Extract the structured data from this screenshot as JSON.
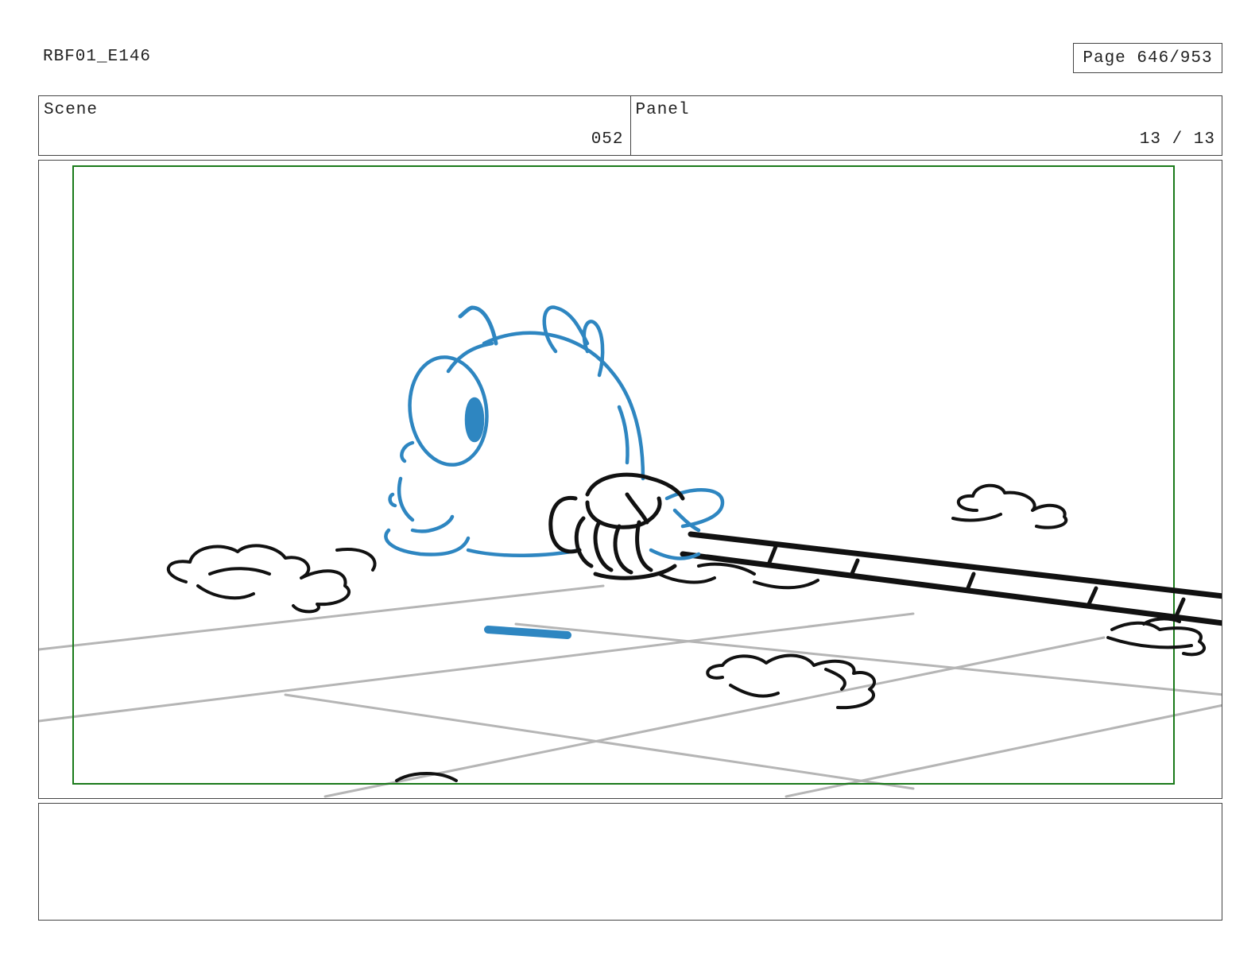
{
  "header": {
    "doc_id": "RBF01_E146",
    "page_label": "Page 646/953"
  },
  "info": {
    "scene_label": "Scene",
    "scene_value": "052",
    "panel_label": "Panel",
    "panel_value": "13 / 13"
  },
  "notes": {
    "text": ""
  },
  "colors": {
    "safe_frame": "#1a7a1a",
    "character_blue": "#2e86c1",
    "ink": "#111111",
    "ground_lines": "#b5b5b5"
  }
}
